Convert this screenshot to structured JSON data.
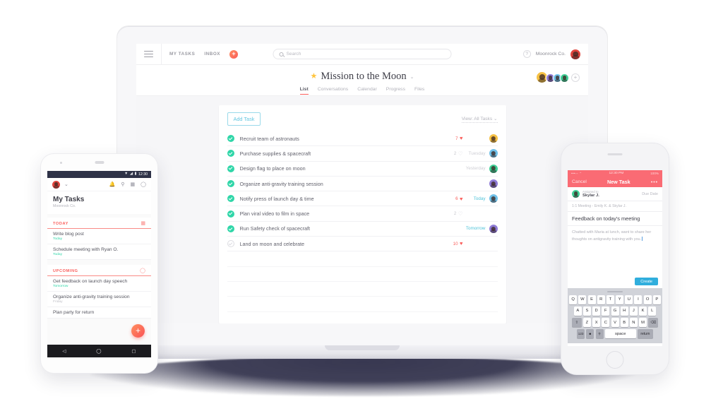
{
  "desktop": {
    "topbar": {
      "menu_icon": "hamburger-icon",
      "links": [
        "MY TASKS",
        "INBOX"
      ],
      "add_label": "+",
      "search_placeholder": "Search",
      "search_icon": "search-icon",
      "help_label": "?",
      "org_name": "Moonrock Co."
    },
    "project": {
      "star_icon": "star-icon",
      "title": "Mission to the Moon",
      "caret": "⌄",
      "tabs": [
        {
          "label": "List",
          "active": true
        },
        {
          "label": "Conversations",
          "active": false
        },
        {
          "label": "Calendar",
          "active": false
        },
        {
          "label": "Progress",
          "active": false
        },
        {
          "label": "Files",
          "active": false
        }
      ],
      "member_add": "+",
      "member_colors": [
        "#f5c044",
        "#8e7bd6",
        "#6fc0e8",
        "#3fcf96"
      ]
    },
    "panel": {
      "add_task_label": "Add Task",
      "view_label": "View: All Tasks ⌄",
      "tasks": [
        {
          "name": "Recruit team of astronauts",
          "done": true,
          "likes": "7",
          "liked": true,
          "due": "",
          "avatar": "#f5c044"
        },
        {
          "name": "Purchase supplies & spacecraft",
          "done": true,
          "likes": "2",
          "liked": false,
          "due": "Tuesday",
          "avatar": "#6fc0e8"
        },
        {
          "name": "Design flag to place on moon",
          "done": true,
          "likes": "",
          "liked": false,
          "due": "Yesterday",
          "avatar": "#3fcf96"
        },
        {
          "name": "Organize anti-gravity training session",
          "done": true,
          "likes": "",
          "liked": false,
          "due": "",
          "avatar": "#8e7bd6"
        },
        {
          "name": "Notify press of launch day & time",
          "done": true,
          "likes": "6",
          "liked": true,
          "due": "Today",
          "avatar": "#6fc0e8"
        },
        {
          "name": "Plan viral video to film in space",
          "done": true,
          "likes": "2",
          "liked": false,
          "due": "",
          "avatar": ""
        },
        {
          "name": "Run Safety check of spacecraft",
          "done": true,
          "likes": "",
          "liked": false,
          "due": "Tomorrow",
          "avatar": "#8e7bd6"
        },
        {
          "name": "Land on moon and celebrate",
          "done": false,
          "likes": "10",
          "liked": true,
          "due": "",
          "avatar": ""
        }
      ]
    }
  },
  "android": {
    "status": {
      "wifi_icon": "wifi-icon",
      "signal_icon": "signal-icon",
      "battery_icon": "battery-icon",
      "time": "12:30"
    },
    "nav_icons": [
      "bell-icon",
      "search-icon",
      "list-icon",
      "chat-icon"
    ],
    "avatar_caret": "⌄",
    "title": "My Tasks",
    "subtitle": "Moonrock Co.",
    "sections": [
      {
        "title": "TODAY",
        "icon": "calendar-icon",
        "tasks": [
          {
            "name": "Write blog post",
            "sub": "Today",
            "sub_gray": false
          },
          {
            "name": "Schedule meeting with Ryan O.",
            "sub": "Today",
            "sub_gray": false
          }
        ]
      },
      {
        "title": "UPCOMING",
        "icon": "circle-icon",
        "tasks": [
          {
            "name": "Get feedback on launch day speech",
            "sub": "Tomorrow",
            "sub_gray": false
          },
          {
            "name": "Organize anti-gravity training session",
            "sub": "Friday",
            "sub_gray": true
          },
          {
            "name": "Plan party for return",
            "sub": "",
            "sub_gray": true
          }
        ]
      }
    ],
    "fab_label": "+",
    "softkeys": [
      "◁",
      "◯",
      "▢"
    ]
  },
  "iphone": {
    "status": {
      "carrier": "•••◦◦ ⌃",
      "time": "12:30 PM",
      "battery": "100%"
    },
    "navbar": {
      "cancel": "Cancel",
      "title": "New Task",
      "more": "•••"
    },
    "assign": {
      "label": "Assigned to",
      "name": "Skylar J.",
      "due_date": "Due Date"
    },
    "breadcrumb": "1:1 Meeting - Emily K. & Skylar J.",
    "task_title": "Feedback on today's meeting",
    "note": "Chatted with Maria at lunch, want to share her thoughts on antigravity training with you.",
    "create_label": "Create",
    "keyboard": {
      "row1": [
        "Q",
        "W",
        "E",
        "R",
        "T",
        "Y",
        "U",
        "I",
        "O",
        "P"
      ],
      "row2": [
        "A",
        "S",
        "D",
        "F",
        "G",
        "H",
        "J",
        "K",
        "L"
      ],
      "row3": [
        "⇧",
        "Z",
        "X",
        "C",
        "V",
        "B",
        "N",
        "M",
        "⌫"
      ],
      "row4": [
        "123",
        "☻",
        "⚲",
        "space",
        "return"
      ]
    }
  }
}
